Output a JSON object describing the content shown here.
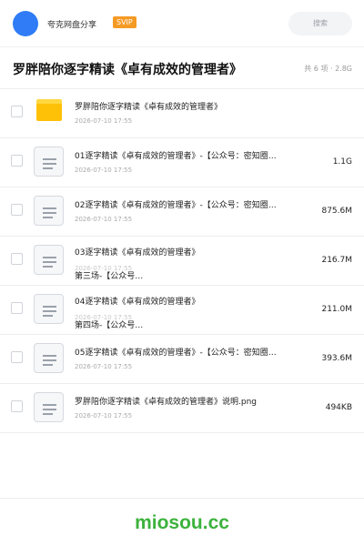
{
  "header": {
    "username": "夸克网盘分享",
    "badge": "SVIP",
    "search_placeholder": "搜索",
    "avatar_color": "#2f7cf6"
  },
  "share": {
    "title": "罗胖陪你逐字精读《卓有成效的管理者》",
    "summary": "共 6 项 · 2.8G"
  },
  "files": [
    {
      "name": "罗胖陪你逐字精读《卓有成效的管理者》",
      "date": "2026-07-10 17:55",
      "size": "",
      "icon": "folder-icon"
    },
    {
      "name": "01逐字精读《卓有成效的管理者》-【公众号：密知圈…",
      "date": "2026-07-10 17:55",
      "size": "1.1G",
      "icon": "document-icon"
    },
    {
      "name": "02逐字精读《卓有成效的管理者》-【公众号：密知圈…",
      "date": "2026-07-10 17:55",
      "size": "875.6M",
      "icon": "document-icon"
    },
    {
      "name": "03逐字精读《卓有成效的管理者》",
      "name2": "第三场-【公众号…",
      "date": "2026-07-10 17:55",
      "size": "216.7M",
      "icon": "document-icon"
    },
    {
      "name": "04逐字精读《卓有成效的管理者》",
      "name2": "第四场-【公众号…",
      "date": "2026-07-10 17:55",
      "size": "211.0M",
      "icon": "document-icon"
    },
    {
      "name": "05逐字精读《卓有成效的管理者》-【公众号：密知圈…",
      "date": "2026-07-10 17:55",
      "size": "393.6M",
      "icon": "document-icon"
    },
    {
      "name": "罗胖陪你逐字精读《卓有成效的管理者》说明.png",
      "date": "2026-07-10 17:55",
      "size": "494KB",
      "icon": "document-icon"
    }
  ],
  "watermark": "miosou.cc",
  "colors": {
    "badge": "#f59a23",
    "folder": "#ffc107",
    "watermark": "#3cb23c"
  }
}
